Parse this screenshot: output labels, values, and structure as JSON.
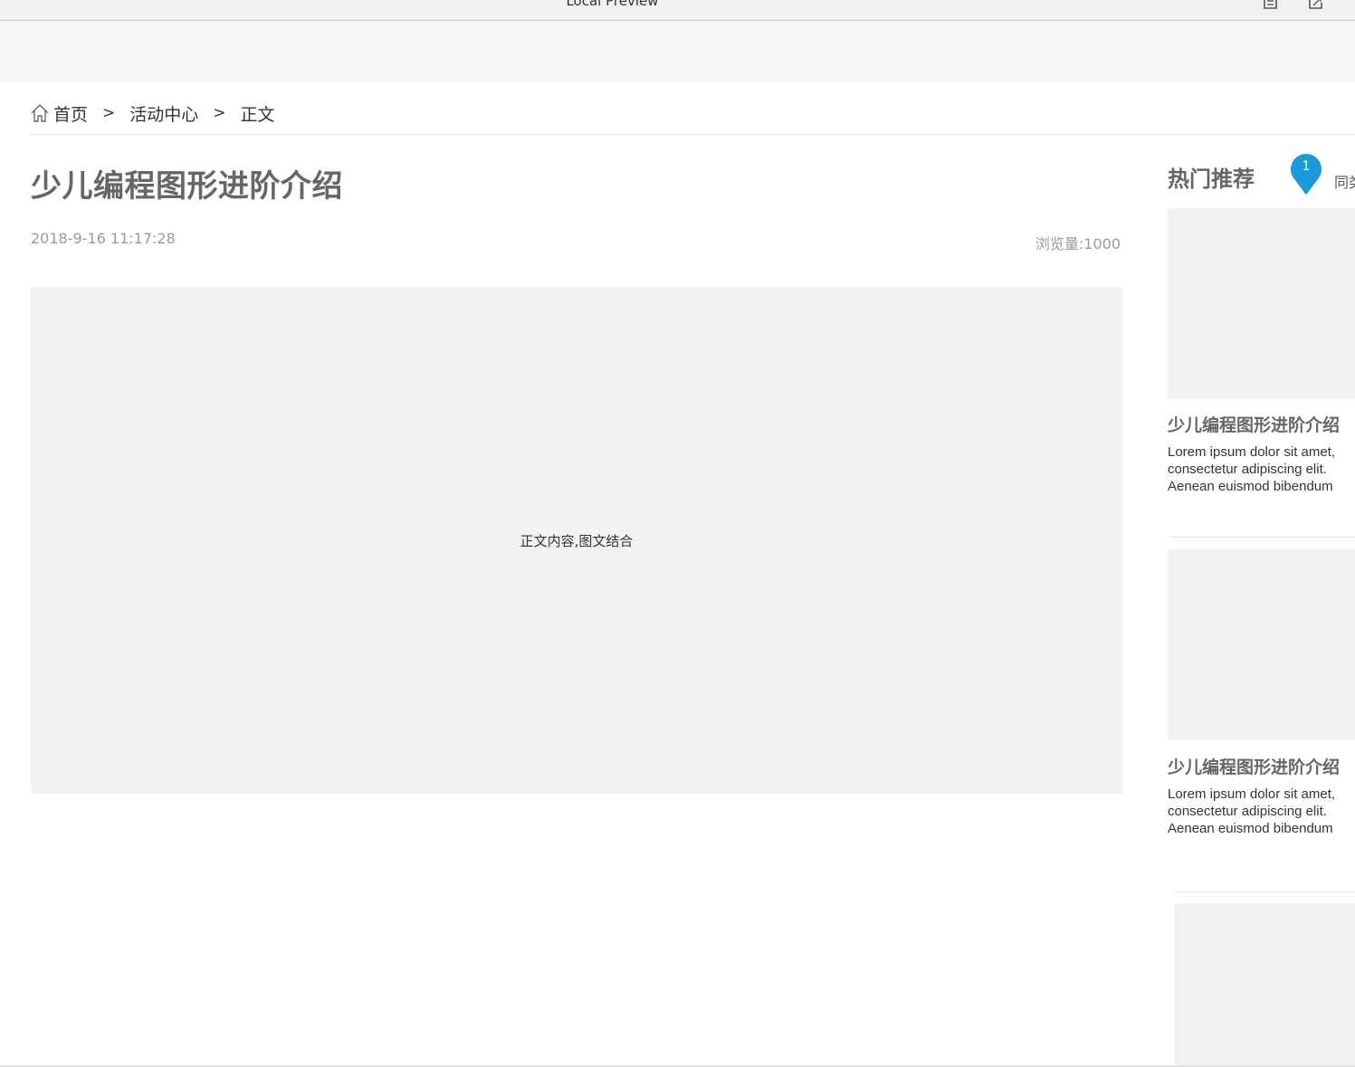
{
  "window": {
    "title": "Local Preview",
    "icons": [
      "document-icon",
      "export-icon"
    ]
  },
  "breadcrumb": {
    "home_icon": "home-icon",
    "items": [
      "首页",
      "活动中心",
      "正文"
    ],
    "separator": ">"
  },
  "article": {
    "title": "少儿编程图形进阶介绍",
    "date": "2018-9-16 11:17:28",
    "views_label": "浏览量:",
    "views_value": "1000",
    "content_placeholder": "正文内容,图文结合"
  },
  "sidebar": {
    "heading": "热门推荐",
    "tab2": "同类",
    "pin_number": "1",
    "pin_color": "#1a9ad6",
    "cards": [
      {
        "title": "少儿编程图形进阶介绍",
        "desc": "Lorem ipsum dolor sit amet, consectetur adipiscing elit. Aenean euismod bibendum laoreet. Proin gravida..."
      },
      {
        "title": "少儿编程图形进阶介绍",
        "desc": "Lorem ipsum dolor sit amet, consectetur adipiscing elit. Aenean euismod bibendum laoreet. Proin gravida..."
      }
    ]
  }
}
